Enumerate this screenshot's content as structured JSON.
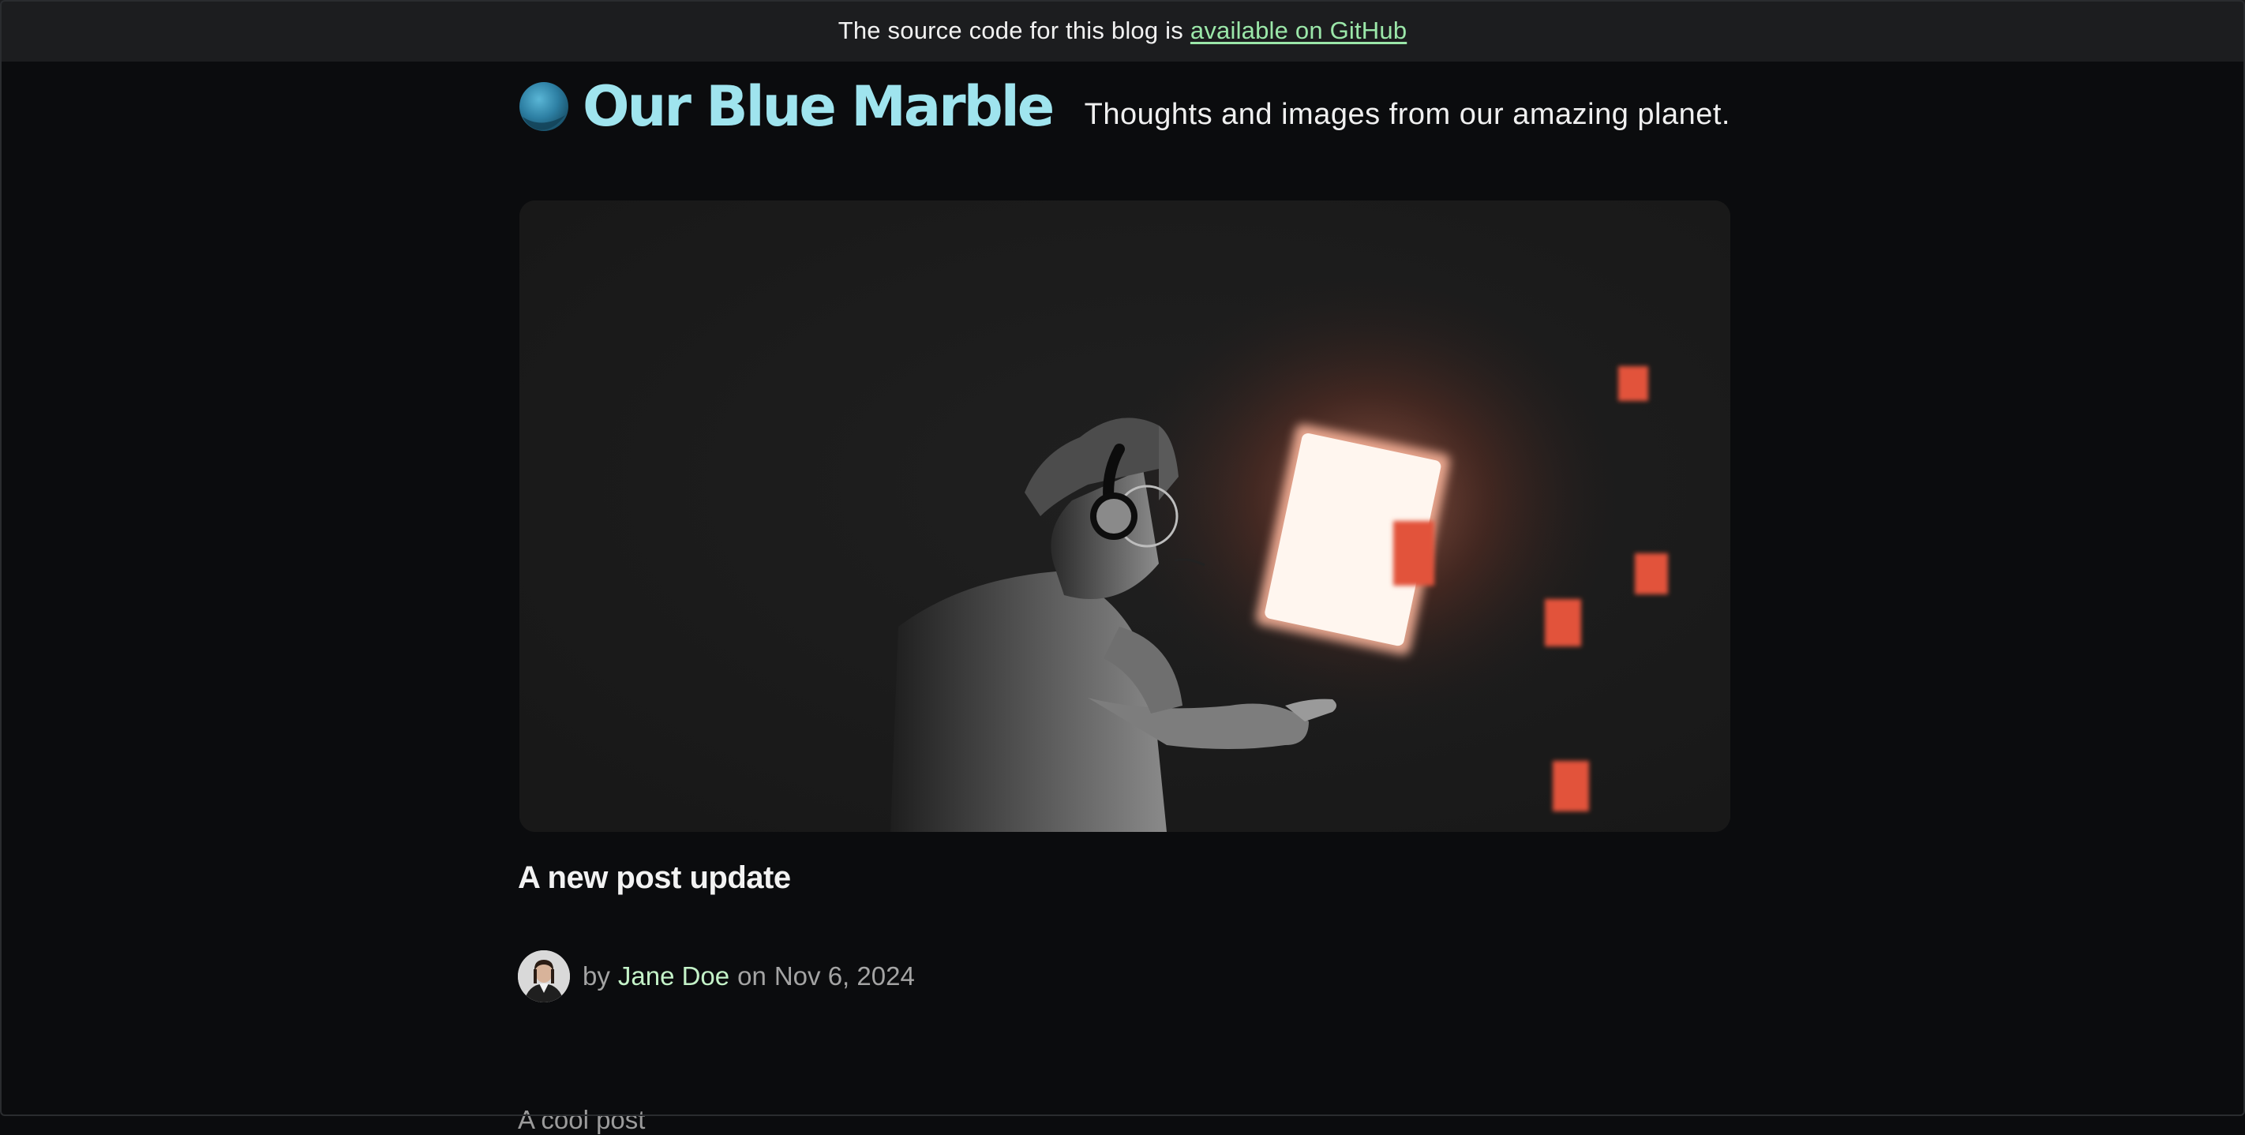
{
  "banner": {
    "text": "The source code for this blog is",
    "link_text": "available on GitHub"
  },
  "header": {
    "site_title": "Our Blue Marble",
    "tagline": "Thoughts and images from our amazing planet.",
    "logo_icon": "blue-marble-icon"
  },
  "post": {
    "hero_image": "person-with-headphones-at-glowing-screen",
    "title": "A new post update",
    "by_label": "by",
    "author": "Jane Doe",
    "on_label": "on",
    "date": "Nov 6, 2024",
    "excerpt": "A cool post"
  },
  "colors": {
    "background": "#0b0c0e",
    "banner_background": "#1c1d1f",
    "link_green": "#9be7a9",
    "brand_cyan": "#9fe4ee",
    "author_green": "#c4f2c8",
    "accent_red": "#e2533a"
  }
}
